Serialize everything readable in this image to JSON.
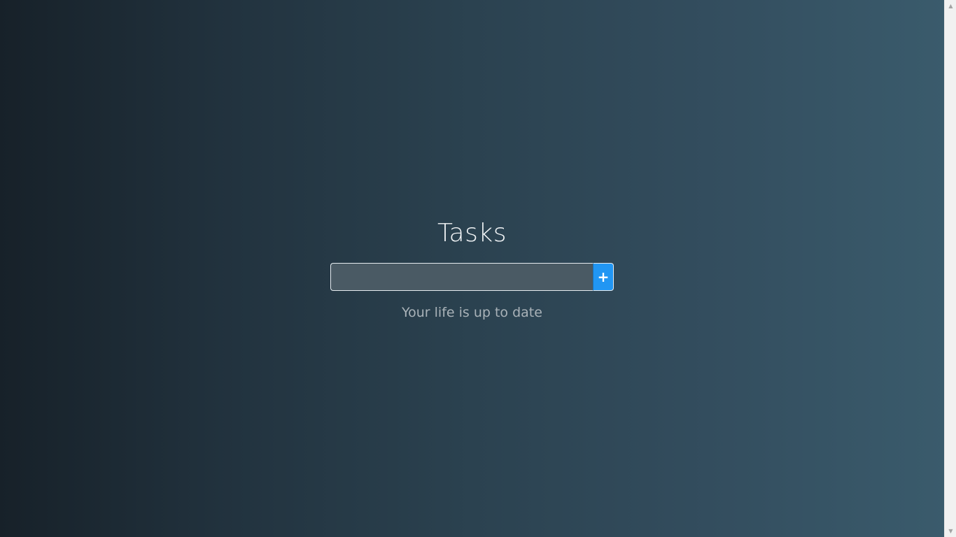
{
  "app": {
    "title": "Tasks"
  },
  "task_form": {
    "input_value": "",
    "input_placeholder": "",
    "add_button_label": "+"
  },
  "status": {
    "message": "Your life is up to date"
  },
  "scrollbar": {
    "up_arrow": "▲",
    "down_arrow": "▼"
  },
  "colors": {
    "gradient_start": "#172129",
    "gradient_end": "#3a5b6c",
    "accent": "#2196f3"
  },
  "icons": {
    "add": "plus-icon",
    "scroll_up": "scroll-up-icon",
    "scroll_down": "scroll-down-icon"
  }
}
